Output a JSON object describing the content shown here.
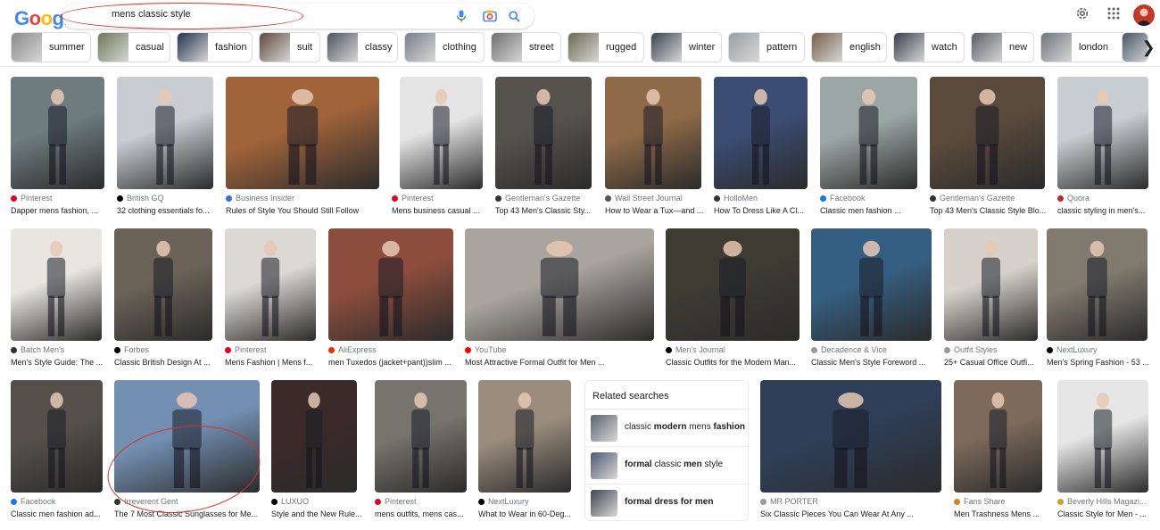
{
  "header": {
    "logo": "Google",
    "search": {
      "value": "mens classic style"
    }
  },
  "chips": [
    {
      "label": "summer",
      "thumb": "#8a8a8a"
    },
    {
      "label": "casual",
      "thumb": "#6b7a55"
    },
    {
      "label": "fashion",
      "thumb": "#23324d"
    },
    {
      "label": "suit",
      "thumb": "#5e4a3c"
    },
    {
      "label": "classy",
      "thumb": "#4e5560"
    },
    {
      "label": "clothing",
      "thumb": "#79808a"
    },
    {
      "label": "street",
      "thumb": "#6f6f6f"
    },
    {
      "label": "rugged",
      "thumb": "#6d6a4e"
    },
    {
      "label": "winter",
      "thumb": "#3c4450"
    },
    {
      "label": "pattern",
      "thumb": "#9aa0a6"
    },
    {
      "label": "english",
      "thumb": "#7a5f4b"
    },
    {
      "label": "watch",
      "thumb": "#3a3f4d"
    },
    {
      "label": "new",
      "thumb": "#5a5f66"
    },
    {
      "label": "london",
      "thumb": "#70767e"
    }
  ],
  "row1": [
    {
      "source": "Pinterest",
      "title": "Dapper mens fashion, ...",
      "img": "#6e7c80",
      "dot": "#e60023"
    },
    {
      "source": "British GQ",
      "title": "32 clothing essentials fo...",
      "img": "#c9cdd2",
      "dot": "#000000"
    },
    {
      "source": "Business Insider",
      "title": "Rules of Style You Should Still Follow",
      "img": "#a0633a",
      "dot": "#2f6fde"
    },
    {
      "source": "Pinterest",
      "title": "Mens business casual ...",
      "img": "#e4e4e4",
      "dot": "#e60023"
    },
    {
      "source": "Gentleman's Gazette",
      "title": "Top 43 Men's Classic Sty...",
      "img": "#55524e",
      "dot": "#333333"
    },
    {
      "source": "Wall Street Journal",
      "title": "How to Wear a Tux—and ...",
      "img": "#8f6a48",
      "dot": "#555555"
    },
    {
      "source": "HolloMen",
      "title": "How To Dress Like A Cl...",
      "img": "#3b4d73",
      "dot": "#333333"
    },
    {
      "source": "Facebook",
      "title": "Classic men fashion ...",
      "img": "#9aa7a4",
      "dot": "#1877f2"
    },
    {
      "source": "Gentleman's Gazette",
      "title": "Top 43 Men's Classic Style Blo...",
      "img": "#5a4a3b",
      "dot": "#333333"
    },
    {
      "source": "Quora",
      "title": "classic styling in men's...",
      "img": "#c7cdd2",
      "dot": "#b92b27"
    }
  ],
  "row2": [
    {
      "source": "Batch Men's",
      "title": "Men's Style Guide: The ...",
      "img": "#e9e6e0",
      "dot": "#333333"
    },
    {
      "source": "Forbes",
      "title": "Classic British Design At ...",
      "img": "#6b6357",
      "dot": "#000000"
    },
    {
      "source": "Pinterest",
      "title": "Mens Fashion | Mens f...",
      "img": "#dcd8d4",
      "dot": "#e60023"
    },
    {
      "source": "AliExpress",
      "title": "men Tuxedos (jacket+pant))slim ...",
      "img": "#8c4d3c",
      "dot": "#e62e04"
    },
    {
      "source": "YouTube",
      "title": "Most Attractive Formal Outfit for Men ...",
      "img": "#a9a49d",
      "dot": "#ff0000"
    },
    {
      "source": "Men's Journal",
      "title": "Classic Outfits for the Modern Man...",
      "img": "#3e3b32",
      "dot": "#000000"
    },
    {
      "source": "Decadence & Vice",
      "title": "Classic Men's Style Foreword ...",
      "img": "#355f82",
      "dot": "#999999"
    },
    {
      "source": "Outfit Styles",
      "title": "25+ Casual Office Outfi...",
      "img": "#d6d2cb",
      "dot": "#999999"
    },
    {
      "source": "NextLuxury",
      "title": "Men's Spring Fashion - 53 ...",
      "img": "#817a6e",
      "dot": "#000000"
    }
  ],
  "row3": [
    {
      "source": "Facebook",
      "title": "Classic men fashion ad...",
      "img": "#55504a",
      "dot": "#1877f2"
    },
    {
      "source": "Irreverent Gent",
      "title": "The 7 Most Classic Sunglasses for Me...",
      "img": "#7390b3",
      "dot": "#333333"
    },
    {
      "source": "LUXUO",
      "title": "Style and the New Rule...",
      "img": "#3b2a28",
      "dot": "#000000"
    },
    {
      "source": "Pinterest",
      "title": "mens outfits, mens cas...",
      "img": "#77736d",
      "dot": "#e60023"
    },
    {
      "source": "NextLuxury",
      "title": "What to Wear in 60-Deg...",
      "img": "#9a8d7d",
      "dot": "#000000"
    },
    {
      "source": "MR PORTER",
      "title": "Six Classic Pieces You Can Wear At Any ...",
      "img": "#2f3f58",
      "dot": "#999999"
    },
    {
      "source": "Fans Share",
      "title": "Men Trashness Mens ...",
      "img": "#7d6a5b",
      "dot": "#c98a1f"
    },
    {
      "source": "Beverly Hills Magazi...",
      "title": "Classic Style for Men - ...",
      "img": "#e6e6e6",
      "dot": "#c9a227"
    }
  ],
  "related": {
    "title": "Related searches",
    "items": [
      {
        "parts": [
          {
            "t": "classic ",
            "b": false
          },
          {
            "t": "modern",
            "b": true
          },
          {
            "t": " mens ",
            "b": false
          },
          {
            "t": "fashion",
            "b": true
          }
        ],
        "thumb": "#5b6270"
      },
      {
        "parts": [
          {
            "t": "formal",
            "b": true
          },
          {
            "t": " classic ",
            "b": false
          },
          {
            "t": "men",
            "b": true
          },
          {
            "t": " style",
            "b": false
          }
        ],
        "thumb": "#4d5a72"
      },
      {
        "parts": [
          {
            "t": "formal dress for men",
            "b": true
          }
        ],
        "thumb": "#3f4650"
      }
    ]
  }
}
